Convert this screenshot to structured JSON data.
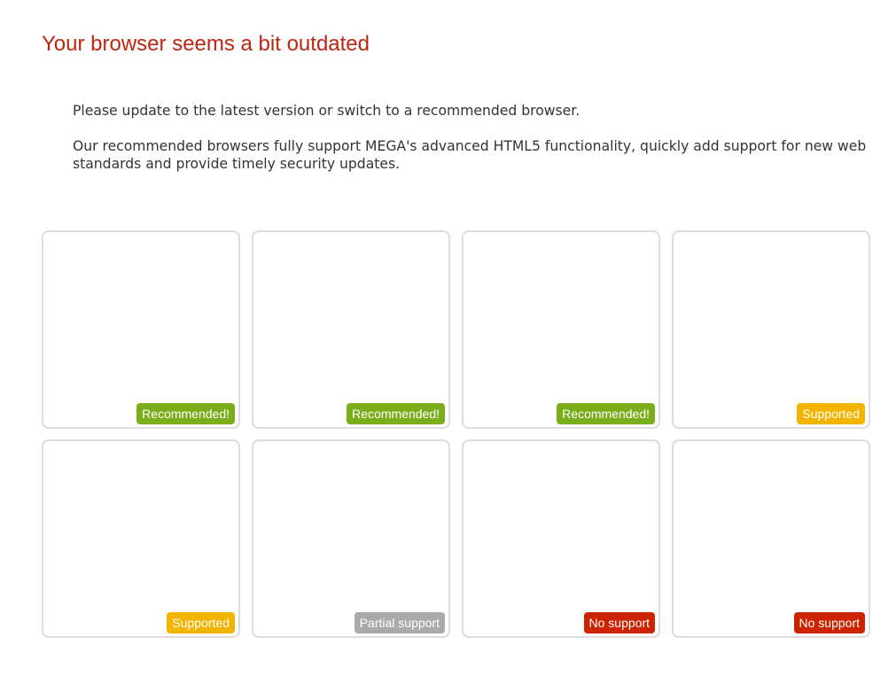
{
  "page": {
    "title": "Your browser seems a bit outdated",
    "title_color": "#c0260f",
    "intro": [
      "Please update to the latest version or switch to a recommended browser.",
      "Our recommended browsers fully support MEGA's advanced HTML5 functionality, quickly add support for new web standards and provide timely security updates."
    ]
  },
  "browsers": [
    {
      "badge": "Recommended!",
      "color": "#79ad1a"
    },
    {
      "badge": "Recommended!",
      "color": "#79ad1a"
    },
    {
      "badge": "Recommended!",
      "color": "#79ad1a"
    },
    {
      "badge": "Supported",
      "color": "#f3b400"
    },
    {
      "badge": "Supported",
      "color": "#f3b400"
    },
    {
      "badge": "Partial support",
      "color": "#aaaaaa"
    },
    {
      "badge": "No support",
      "color": "#cc2400"
    },
    {
      "badge": "No support",
      "color": "#cc2400"
    }
  ]
}
